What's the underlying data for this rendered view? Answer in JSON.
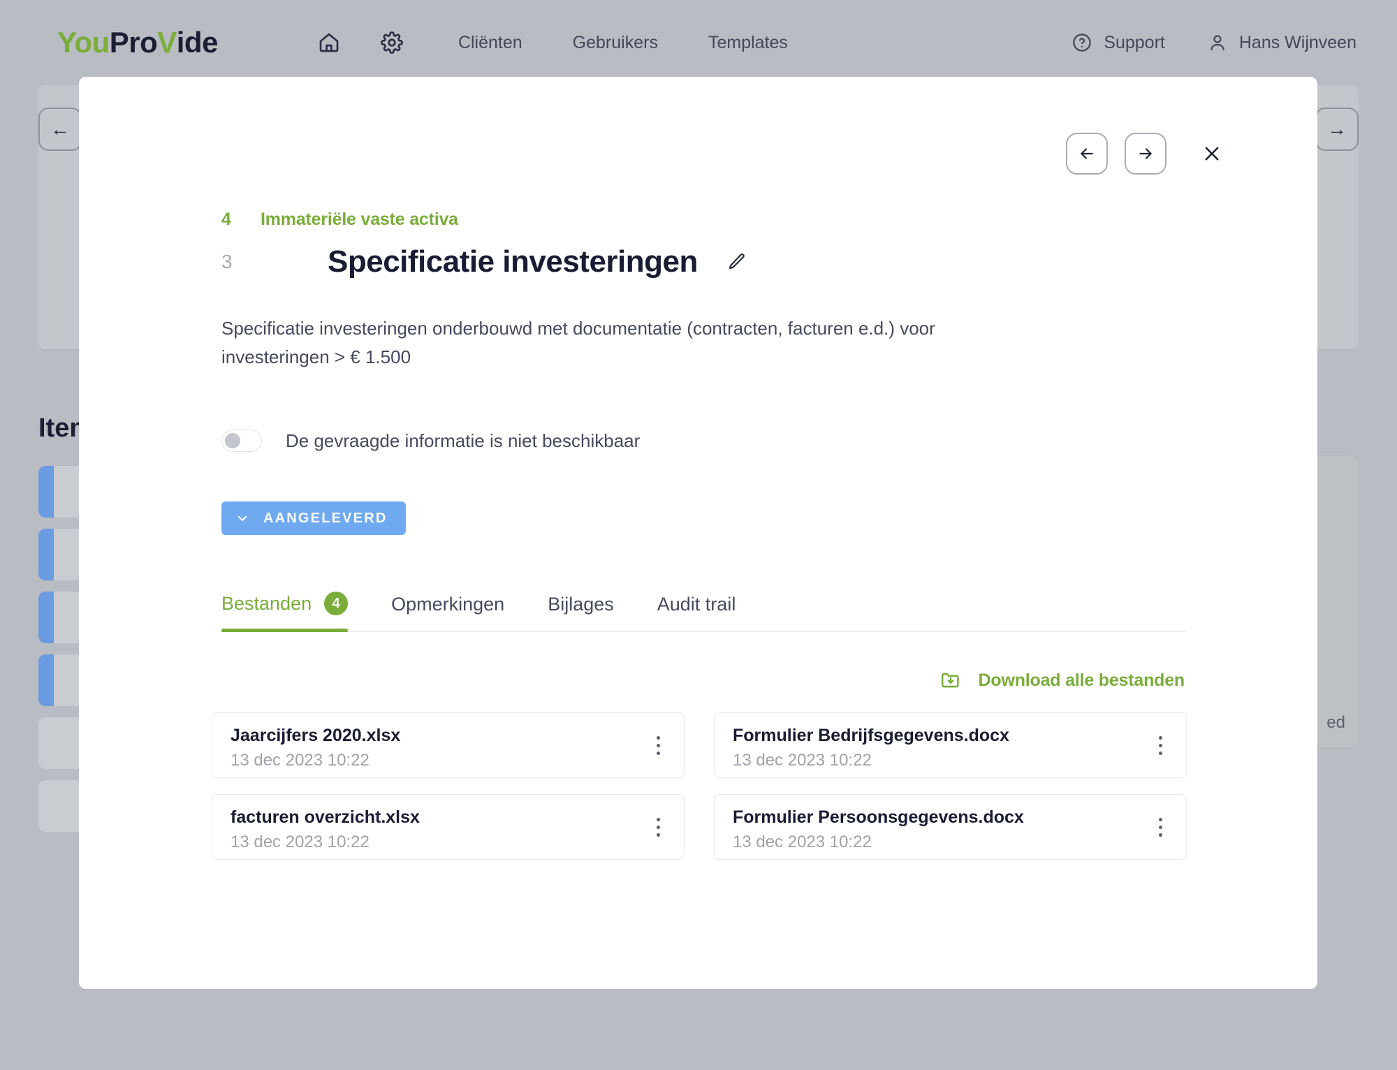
{
  "topnav": {
    "logo": {
      "part1": "You",
      "part2": "Pro",
      "part3": "V",
      "part4": "ide"
    },
    "home_icon": "home-icon",
    "settings_icon": "gear-icon",
    "links": [
      {
        "label": "Cliënten"
      },
      {
        "label": "Gebruikers"
      },
      {
        "label": "Templates"
      }
    ],
    "support": {
      "label": "Support",
      "icon": "question-circle-icon"
    },
    "user": {
      "label": "Hans Wijnveen",
      "icon": "person-icon"
    }
  },
  "background": {
    "heading": "Items",
    "back_arrow": "←",
    "forward_arrow": "→",
    "side_panel_text": "ed"
  },
  "modal": {
    "nav": {
      "prev_label": "←",
      "next_label": "→",
      "close_label": "×"
    },
    "breadcrumb": {
      "number": "4",
      "label": "Immateriële vaste activa"
    },
    "title": {
      "number": "3",
      "text": "Specificatie investeringen",
      "edit_icon": "pencil-icon"
    },
    "description": "Specificatie investeringen onderbouwd met documentatie (contracten, facturen e.d.) voor investeringen > € 1.500",
    "toggle": {
      "label": "De gevraagde informatie is niet beschikbaar",
      "checked": false
    },
    "status_button": {
      "label": "AANGELEVERD",
      "icon": "chevron-down-icon",
      "color": "#6faaf0"
    },
    "tabs": [
      {
        "label": "Bestanden",
        "badge": "4",
        "active": true
      },
      {
        "label": "Opmerkingen",
        "badge": "",
        "active": false
      },
      {
        "label": "Bijlages",
        "badge": "",
        "active": false
      },
      {
        "label": "Audit trail",
        "badge": "",
        "active": false
      }
    ],
    "download_all": {
      "label": "Download alle bestanden",
      "icon": "folder-download-icon"
    },
    "files": [
      {
        "name": "Jaarcijfers 2020.xlsx",
        "date": "13 dec 2023 10:22"
      },
      {
        "name": "Formulier Bedrijfsgegevens.docx",
        "date": "13 dec 2023 10:22"
      },
      {
        "name": "facturen overzicht.xlsx",
        "date": "13 dec 2023 10:22"
      },
      {
        "name": "Formulier Persoonsgegevens.docx",
        "date": "13 dec 2023 10:22"
      }
    ]
  },
  "colors": {
    "brand_green": "#7aad3a",
    "accent_blue": "#6faaf0",
    "dark_text": "#191c33",
    "muted_text": "#9fa2ac"
  }
}
